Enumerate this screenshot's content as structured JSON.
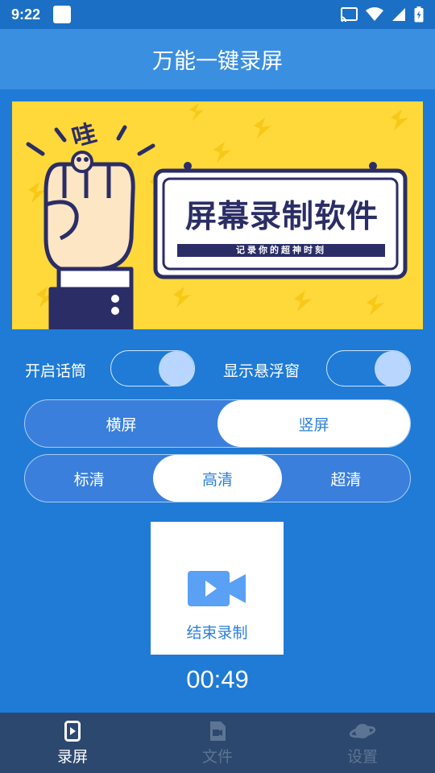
{
  "status_bar": {
    "time": "9:22"
  },
  "header": {
    "title": "万能一键录屏"
  },
  "banner": {
    "exclamation": "哇",
    "title": "屏幕录制软件",
    "subtitle": "记录你的超神时刻"
  },
  "settings": {
    "mic_label": "开启话筒",
    "mic_on": true,
    "float_label": "显示悬浮窗",
    "float_on": true
  },
  "orientation": {
    "options": [
      "横屏",
      "竖屏"
    ],
    "selected": "竖屏"
  },
  "quality": {
    "options": [
      "标清",
      "高清",
      "超清"
    ],
    "selected": "高清"
  },
  "record": {
    "label": "结束录制",
    "timer": "00:49"
  },
  "nav": {
    "items": [
      {
        "label": "录屏",
        "icon": "phone-record-icon",
        "active": true
      },
      {
        "label": "文件",
        "icon": "video-file-icon",
        "active": false
      },
      {
        "label": "设置",
        "icon": "planet-icon",
        "active": false
      }
    ]
  },
  "colors": {
    "primary": "#1f7bd6",
    "title_bar": "#3a8fe0",
    "nav_bg": "#2d486e",
    "banner_bg": "#ffd93a"
  }
}
